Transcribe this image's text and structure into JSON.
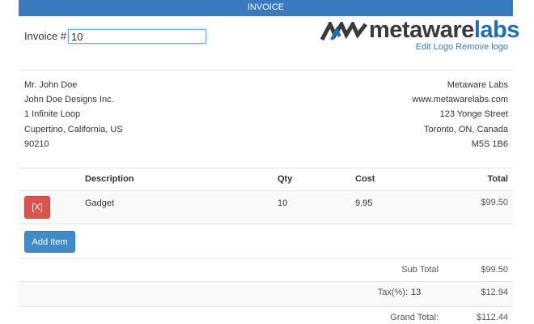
{
  "header": {
    "title": "INVOICE"
  },
  "invoice": {
    "label": "Invoice #",
    "number": "10"
  },
  "logo": {
    "word1": "metaware",
    "word2": "labs",
    "edit_label": "Edit Logo",
    "remove_label": "Remove logo"
  },
  "billed_to": {
    "lines": [
      "Mr. John Doe",
      "John Doe Designs Inc.",
      "1 Infinite Loop",
      "Cupertino, California, US",
      "90210"
    ]
  },
  "company": {
    "lines": [
      "Metaware Labs",
      "www.metawarelabs.com",
      "123 Yonge Street",
      "Toronto, ON, Canada",
      "M5S 1B6"
    ]
  },
  "table": {
    "headers": {
      "description": "Description",
      "qty": "Qty",
      "cost": "Cost",
      "total": "Total"
    },
    "rows": [
      {
        "delete_label": "[X]",
        "description": "Gadget",
        "qty": "10",
        "cost": "9.95",
        "total": "$99.50"
      }
    ],
    "add_item_label": "Add Item"
  },
  "totals": {
    "subtotal_label": "Sub Total",
    "subtotal_value": "$99.50",
    "tax_label": "Tax(%):",
    "tax_rate": "13",
    "tax_value": "$12.94",
    "grand_label": "Grand Total:",
    "grand_value": "$112.44"
  },
  "colors": {
    "primary": "#428bca",
    "danger": "#d9534f",
    "header": "#3a7bbf",
    "brand_dark": "#3a3a3a",
    "brand_blue": "#1d6fb8"
  }
}
